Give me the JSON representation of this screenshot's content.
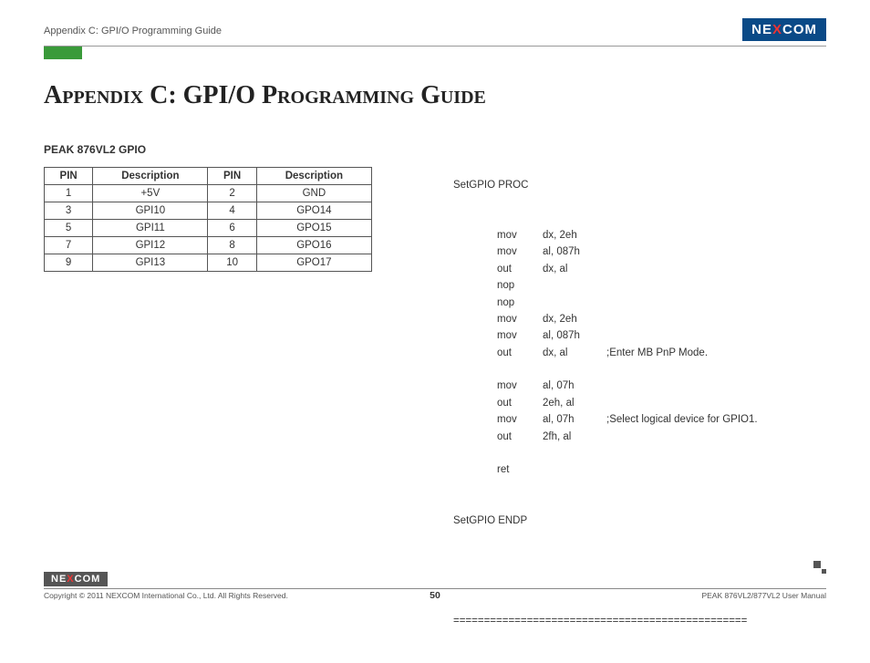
{
  "header": {
    "breadcrumb": "Appendix C: GPI/O Programming Guide",
    "logo_text_pre": "NE",
    "logo_text_x": "X",
    "logo_text_post": "COM"
  },
  "title": "Appendix C: GPI/O Programming Guide",
  "left": {
    "subhead": "PEAK 876VL2 GPIO",
    "columns": [
      "PIN",
      "Description",
      "PIN",
      "Description"
    ],
    "rows": [
      [
        "1",
        "+5V",
        "2",
        "GND"
      ],
      [
        "3",
        "GPI10",
        "4",
        "GPO14"
      ],
      [
        "5",
        "GPI11",
        "6",
        "GPO15"
      ],
      [
        "7",
        "GPI12",
        "8",
        "GPO16"
      ],
      [
        "9",
        "GPI13",
        "10",
        "GPO17"
      ]
    ]
  },
  "code": {
    "open": "SetGPIO PROC",
    "lines": [
      {
        "m": "mov",
        "o": "dx, 2eh",
        "c": ""
      },
      {
        "m": "mov",
        "o": "al, 087h",
        "c": ""
      },
      {
        "m": "out",
        "o": "dx, al",
        "c": ""
      },
      {
        "m": "nop",
        "o": "",
        "c": ""
      },
      {
        "m": "nop",
        "o": "",
        "c": ""
      },
      {
        "m": "mov",
        "o": "dx, 2eh",
        "c": ""
      },
      {
        "m": "mov",
        "o": "al, 087h",
        "c": ""
      },
      {
        "m": "out",
        "o": "dx, al",
        "c": ";Enter MB PnP Mode."
      },
      {
        "m": "",
        "o": "",
        "c": ""
      },
      {
        "m": "mov",
        "o": "al, 07h",
        "c": ""
      },
      {
        "m": "out",
        "o": "2eh, al",
        "c": ""
      },
      {
        "m": "mov",
        "o": "al, 07h",
        "c": ";Select logical device for GPIO1."
      },
      {
        "m": "out",
        "o": "2fh, al",
        "c": ""
      },
      {
        "m": "",
        "o": "",
        "c": ""
      },
      {
        "m": "ret",
        "o": "",
        "c": ""
      }
    ],
    "close": "SetGPIO ENDP",
    "separator": "================================================"
  },
  "footer": {
    "logo_text_pre": "NE",
    "logo_text_x": "X",
    "logo_text_post": "COM",
    "copyright": "Copyright © 2011 NEXCOM International Co., Ltd. All Rights Reserved.",
    "page": "50",
    "manual": "PEAK 876VL2/877VL2 User Manual"
  }
}
